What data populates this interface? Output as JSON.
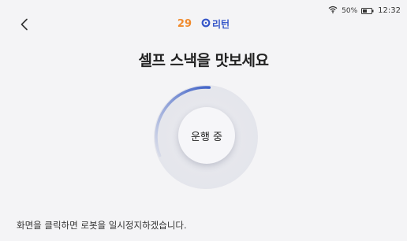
{
  "status_bar": {
    "battery_percent": "50%",
    "battery_level": 0.5,
    "time": "12:32"
  },
  "header": {
    "countdown": "29",
    "return_label": "리턴"
  },
  "title": "셀프 스낵을 맛보세요",
  "status_button": {
    "label": "운행 중"
  },
  "progress": {
    "fraction": 0.14
  },
  "hint": "화면을 클릭하면 로봇을 일시정지하겠습니다.",
  "colors": {
    "background": "#f4f4f6",
    "countdown": "#f08a2c",
    "accent": "#3556c9",
    "ring": "#4264c8"
  },
  "icons": {
    "back": "chevron-left-icon",
    "wifi": "wifi-icon",
    "battery": "battery-icon",
    "return": "return-icon"
  }
}
